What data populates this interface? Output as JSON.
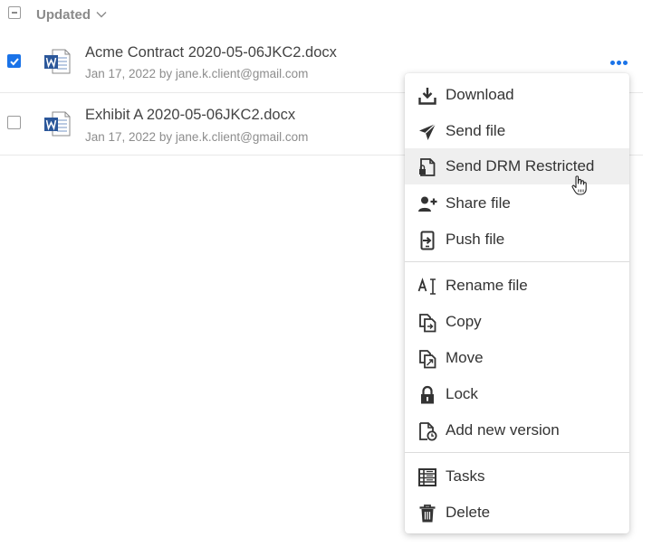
{
  "header": {
    "sort_label": "Updated",
    "sort_icon": "chevron-down-icon"
  },
  "files": [
    {
      "name": "Acme Contract 2020-05-06JKC2.docx",
      "meta": "Jan 17, 2022 by jane.k.client@gmail.com",
      "checked": true,
      "icon": "word-doc-icon"
    },
    {
      "name": "Exhibit A 2020-05-06JKC2.docx",
      "meta": "Jan 17, 2022 by jane.k.client@gmail.com",
      "checked": false,
      "icon": "word-doc-icon"
    }
  ],
  "row_actions_icon": "more-horizontal-icon",
  "context_menu": {
    "items": [
      {
        "label": "Download",
        "icon": "download-icon"
      },
      {
        "label": "Send file",
        "icon": "send-icon"
      },
      {
        "label": "Send DRM Restricted",
        "icon": "drm-file-icon",
        "hovered": true
      },
      {
        "label": "Share file",
        "icon": "add-user-icon"
      },
      {
        "label": "Push file",
        "icon": "push-device-icon"
      },
      {
        "label": "Rename file",
        "icon": "rename-icon"
      },
      {
        "label": "Copy",
        "icon": "copy-icon"
      },
      {
        "label": "Move",
        "icon": "move-icon"
      },
      {
        "label": "Lock",
        "icon": "lock-icon"
      },
      {
        "label": "Add new version",
        "icon": "new-version-icon"
      },
      {
        "label": "Tasks",
        "icon": "tasks-icon"
      },
      {
        "label": "Delete",
        "icon": "trash-icon"
      }
    ]
  },
  "colors": {
    "accent": "#1a73e8",
    "word_blue": "#2b579a",
    "menu_hover": "#efefef",
    "text": "#333333",
    "muted": "#8d8d8d"
  }
}
